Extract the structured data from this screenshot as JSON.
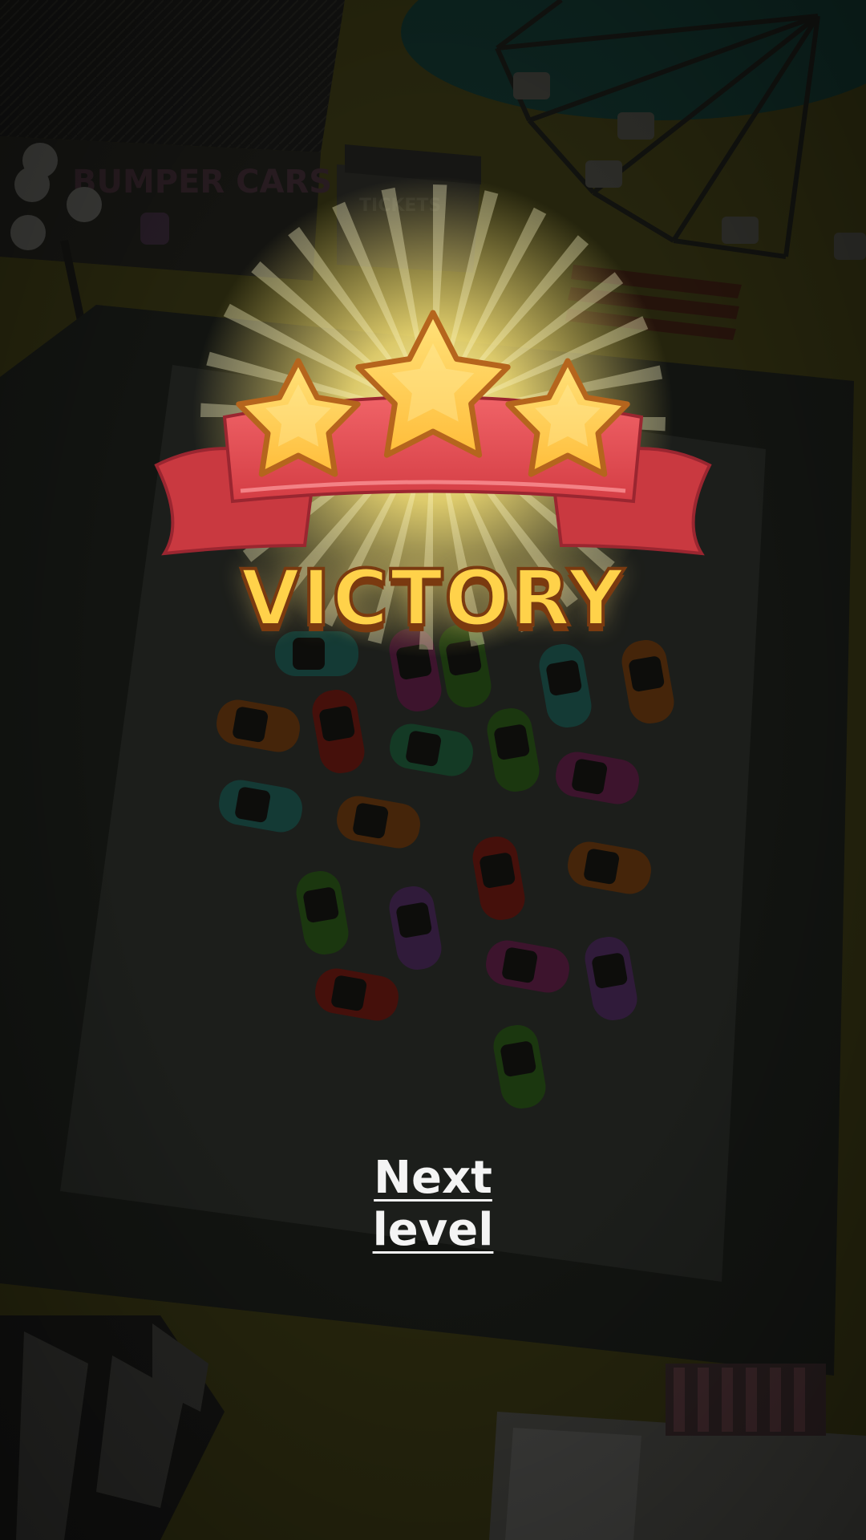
{
  "scene": {
    "sign_text": "BUMPER CARS",
    "tickets_text": "TICKETS",
    "colors": {
      "ground": "#3a3814",
      "arena_border": "#1d201b",
      "arena_floor": "#2c2e2a",
      "fence": "#262823"
    },
    "cars": [
      {
        "color": "#1f5a52"
      },
      {
        "color": "#5e1f45"
      },
      {
        "color": "#2a5518"
      },
      {
        "color": "#1f5a52"
      },
      {
        "color": "#6a3a10"
      },
      {
        "color": "#6a3a10"
      },
      {
        "color": "#6a1a12"
      },
      {
        "color": "#1f5a3a"
      },
      {
        "color": "#2a5518"
      },
      {
        "color": "#5e1f45"
      },
      {
        "color": "#1f5a52"
      },
      {
        "color": "#6a3a10"
      },
      {
        "color": "#6a1a12"
      },
      {
        "color": "#6a3a10"
      },
      {
        "color": "#2a5518"
      },
      {
        "color": "#4a2a5a"
      },
      {
        "color": "#5e1f45"
      },
      {
        "color": "#4a2a5a"
      },
      {
        "color": "#6a1a12"
      },
      {
        "color": "#2a5518"
      }
    ]
  },
  "victory": {
    "title": "VICTORY",
    "stars_earned": 3,
    "stars_total": 3,
    "colors": {
      "ribbon": "#e0474c",
      "star": "#ffc93c",
      "title": "#ffd24a"
    }
  },
  "next_level_label": "Next level"
}
